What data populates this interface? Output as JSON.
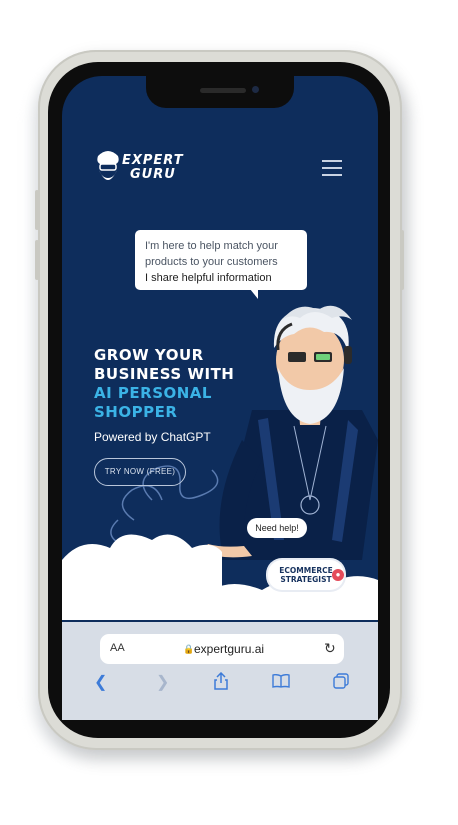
{
  "header": {
    "logo_line1": "EXPERT",
    "logo_line2": "GURU",
    "menu_icon": "hamburger-icon"
  },
  "bubble": {
    "line1": "I'm here to help match your",
    "line2": "products to your customers",
    "line3": "I share helpful information"
  },
  "hero": {
    "title_line1": "GROW YOUR",
    "title_line2": "BUSINESS WITH",
    "title_line3": "AI PERSONAL",
    "title_line4": "SHOPPER",
    "subtitle": "Powered by ChatGPT",
    "cta_label": "TRY NOW (FREE)"
  },
  "illustration": {
    "need_help_label": "Need help!",
    "badge_line1": "ECOMMERCE",
    "badge_line2": "STRATEGIST"
  },
  "browser": {
    "text_size_label": "AA",
    "url": "expertguru.ai",
    "icons": [
      "back-icon",
      "forward-icon",
      "share-icon",
      "bookmarks-icon",
      "tabs-icon"
    ]
  },
  "colors": {
    "background": "#0e2d5c",
    "accent": "#3bb3e6",
    "browser_bar": "#d7dde6",
    "link_blue": "#3d7bd8"
  }
}
